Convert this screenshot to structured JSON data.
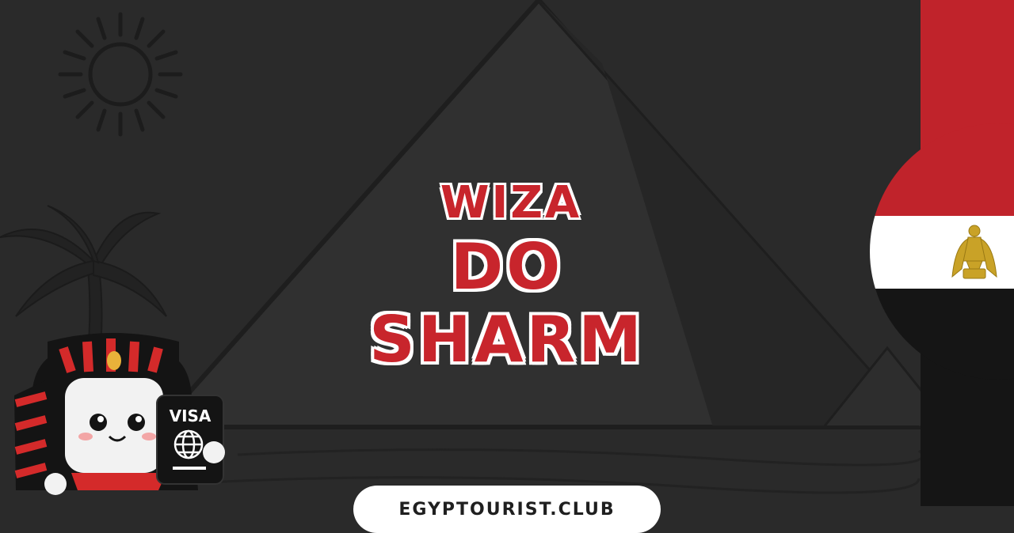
{
  "title": {
    "line1": "WIZA",
    "line2": "DO SHARM"
  },
  "badge": {
    "text": "EGYPTOURIST.CLUB"
  },
  "mascot": {
    "card_label": "VISA"
  },
  "colors": {
    "background": "#2a2a2a",
    "title_red": "#c8252c",
    "flag_red": "#c0232b",
    "flag_white": "#ffffff",
    "flag_black": "#151515",
    "eagle_gold": "#c9a227"
  },
  "icons": [
    "sun-icon",
    "pyramid-illustration",
    "palm-tree-icon",
    "pharaoh-mascot",
    "globe-icon",
    "egypt-flag",
    "eagle-emblem-icon"
  ]
}
